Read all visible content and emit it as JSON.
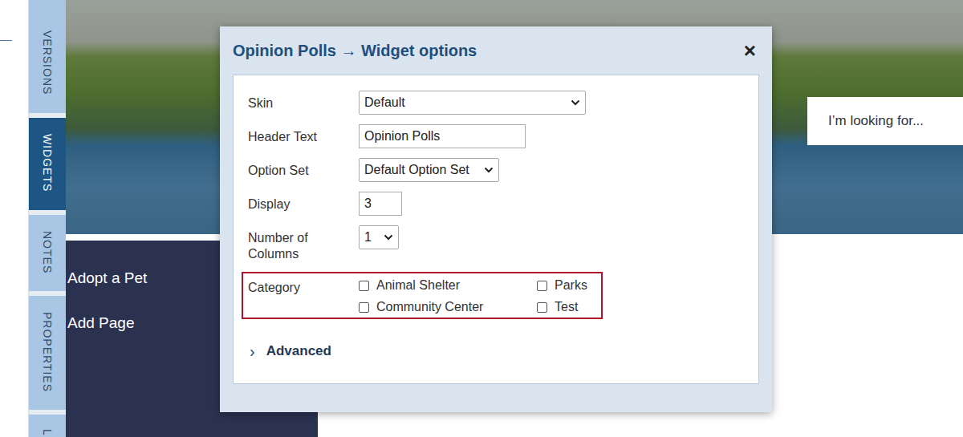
{
  "sidebar_tabs": [
    {
      "label": "VERSIONS",
      "selected": false
    },
    {
      "label": "WIDGETS",
      "selected": true
    },
    {
      "label": "NOTES",
      "selected": false
    },
    {
      "label": "PROPERTIES",
      "selected": false
    },
    {
      "label": "L",
      "selected": false
    }
  ],
  "nav_items": [
    "Adopt a Pet",
    "Add Page"
  ],
  "search": {
    "placeholder": "I’m looking for..."
  },
  "dialog": {
    "title": "Opinion Polls → Widget options",
    "close": "×",
    "fields": [
      {
        "label": "Skin",
        "kind": "select",
        "value": "Default"
      },
      {
        "label": "Header Text",
        "kind": "input",
        "value": "Opinion Polls"
      },
      {
        "label": "Option Set",
        "kind": "select",
        "value": "Default Option Set"
      },
      {
        "label": "Display",
        "kind": "input",
        "value": "3"
      },
      {
        "label": "Number of Columns",
        "kind": "select",
        "value": "1"
      }
    ],
    "category": {
      "label": "Category",
      "options": [
        {
          "label": "Animal Shelter",
          "checked": false
        },
        {
          "label": "Community Center",
          "checked": false
        },
        {
          "label": "Parks",
          "checked": false
        },
        {
          "label": "Test",
          "checked": false
        }
      ]
    },
    "advanced": {
      "label": "Advanced",
      "icon": "›",
      "expanded": false
    }
  }
}
